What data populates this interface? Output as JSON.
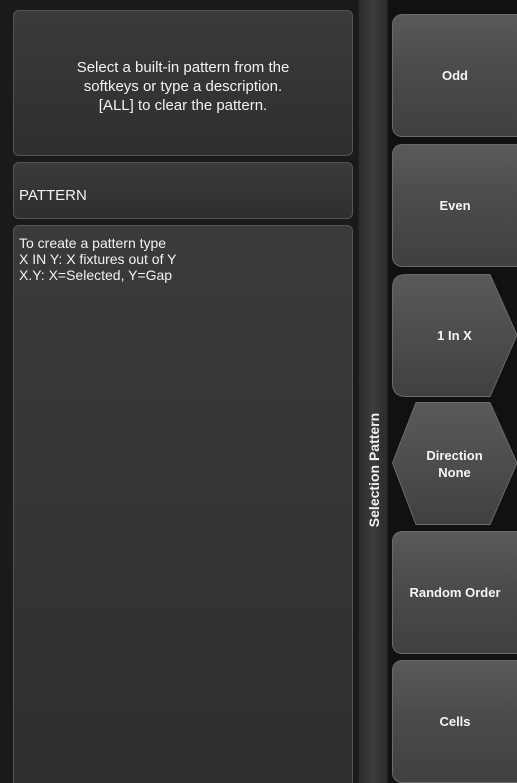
{
  "instructions": {
    "text": "Select a built-in pattern from the\nsoftkeys or type a description.\n[ALL] to clear the pattern."
  },
  "command_line": {
    "text": "PATTERN"
  },
  "help": {
    "text": "To create a pattern type\nX IN Y: X fixtures out of Y\nX.Y: X=Selected, Y=Gap"
  },
  "strip": {
    "label": "Selection Pattern"
  },
  "softkeys": [
    {
      "label": "Odd"
    },
    {
      "label": "Even"
    },
    {
      "label": "1 In X"
    },
    {
      "label": "Direction\nNone"
    },
    {
      "label": "Random Order"
    },
    {
      "label": "Cells"
    }
  ]
}
